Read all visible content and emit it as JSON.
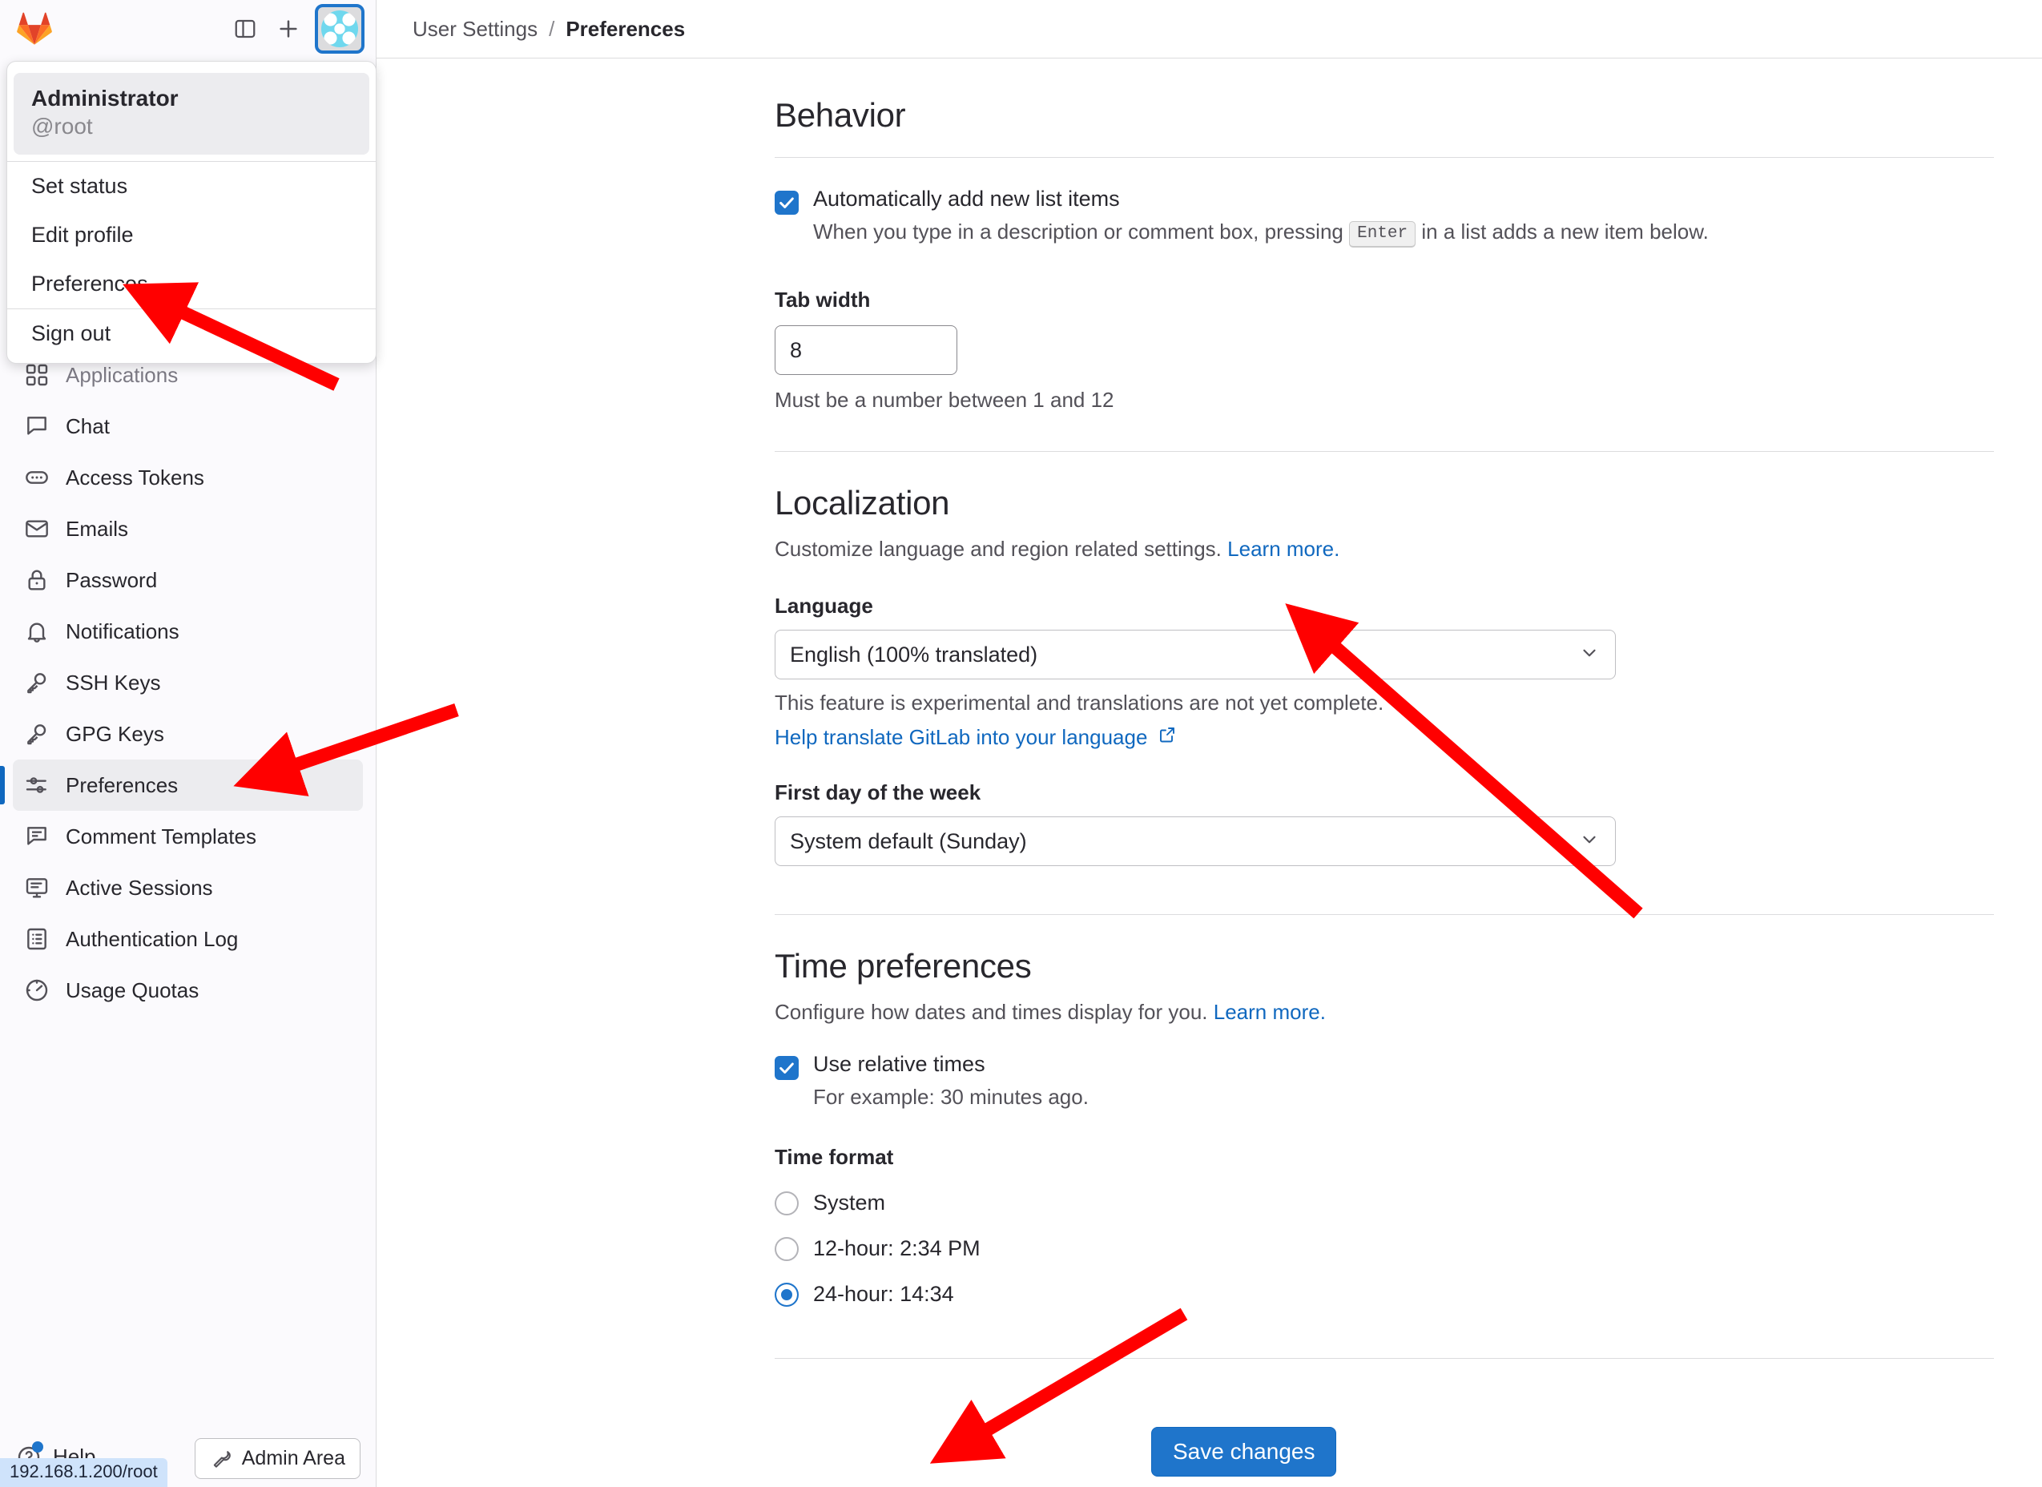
{
  "topbar": {
    "logo_name": "gitlab-logo",
    "sidebar_toggle_name": "toggle-sidebar-icon",
    "new_name": "new-item-icon",
    "avatar_name": "user-avatar"
  },
  "user_menu": {
    "name": "Administrator",
    "handle": "@root",
    "items": [
      {
        "label": "Set status",
        "name": "menu-item-set-status"
      },
      {
        "label": "Edit profile",
        "name": "menu-item-edit-profile"
      },
      {
        "label": "Preferences",
        "name": "menu-item-preferences"
      },
      {
        "label": "Sign out",
        "name": "menu-item-sign-out"
      }
    ]
  },
  "sidebar": {
    "items": [
      {
        "label": "Applications",
        "icon": "applications-icon",
        "active": false,
        "occluded": true
      },
      {
        "label": "Chat",
        "icon": "chat-icon",
        "active": false
      },
      {
        "label": "Access Tokens",
        "icon": "token-icon",
        "active": false
      },
      {
        "label": "Emails",
        "icon": "mail-icon",
        "active": false
      },
      {
        "label": "Password",
        "icon": "lock-icon",
        "active": false
      },
      {
        "label": "Notifications",
        "icon": "bell-icon",
        "active": false
      },
      {
        "label": "SSH Keys",
        "icon": "key-icon",
        "active": false
      },
      {
        "label": "GPG Keys",
        "icon": "key-icon",
        "active": false
      },
      {
        "label": "Preferences",
        "icon": "preferences-sliders-icon",
        "active": true
      },
      {
        "label": "Comment Templates",
        "icon": "comment-lines-icon",
        "active": false
      },
      {
        "label": "Active Sessions",
        "icon": "monitor-icon",
        "active": false
      },
      {
        "label": "Authentication Log",
        "icon": "list-icon",
        "active": false
      },
      {
        "label": "Usage Quotas",
        "icon": "quota-gauge-icon",
        "active": false
      }
    ],
    "help_label": "Help",
    "admin_area_label": "Admin Area",
    "status_url": "192.168.1.200/root"
  },
  "breadcrumb": {
    "root": "User Settings",
    "separator": "/",
    "current": "Preferences"
  },
  "behavior": {
    "title": "Behavior",
    "auto_add_label": "Automatically add new list items",
    "auto_add_desc_before": "When you type in a description or comment box, pressing",
    "auto_add_key": "Enter",
    "auto_add_desc_after": "in a list adds a new item below.",
    "tab_width_label": "Tab width",
    "tab_width_value": "8",
    "tab_width_help": "Must be a number between 1 and 12"
  },
  "localization": {
    "title": "Localization",
    "subtitle": "Customize language and region related settings.",
    "subtitle_link": "Learn more.",
    "language_label": "Language",
    "language_value": "English (100% translated)",
    "language_help": "This feature is experimental and translations are not yet complete.",
    "translate_link": "Help translate GitLab into your language",
    "first_day_label": "First day of the week",
    "first_day_value": "System default (Sunday)"
  },
  "time_preferences": {
    "title": "Time preferences",
    "subtitle": "Configure how dates and times display for you.",
    "subtitle_link": "Learn more.",
    "relative_label": "Use relative times",
    "relative_desc": "For example: 30 minutes ago.",
    "time_format_label": "Time format",
    "options": [
      {
        "label": "System",
        "selected": false
      },
      {
        "label": "12-hour: 2:34 PM",
        "selected": false
      },
      {
        "label": "24-hour: 14:34",
        "selected": true
      }
    ]
  },
  "footer": {
    "save_label": "Save changes"
  },
  "colors": {
    "accent": "#1f75cb",
    "link": "#1068bf",
    "annotation_arrow": "#ff0000",
    "sidebar_bg": "#fbfafd",
    "active_item_bg": "#ececef"
  }
}
